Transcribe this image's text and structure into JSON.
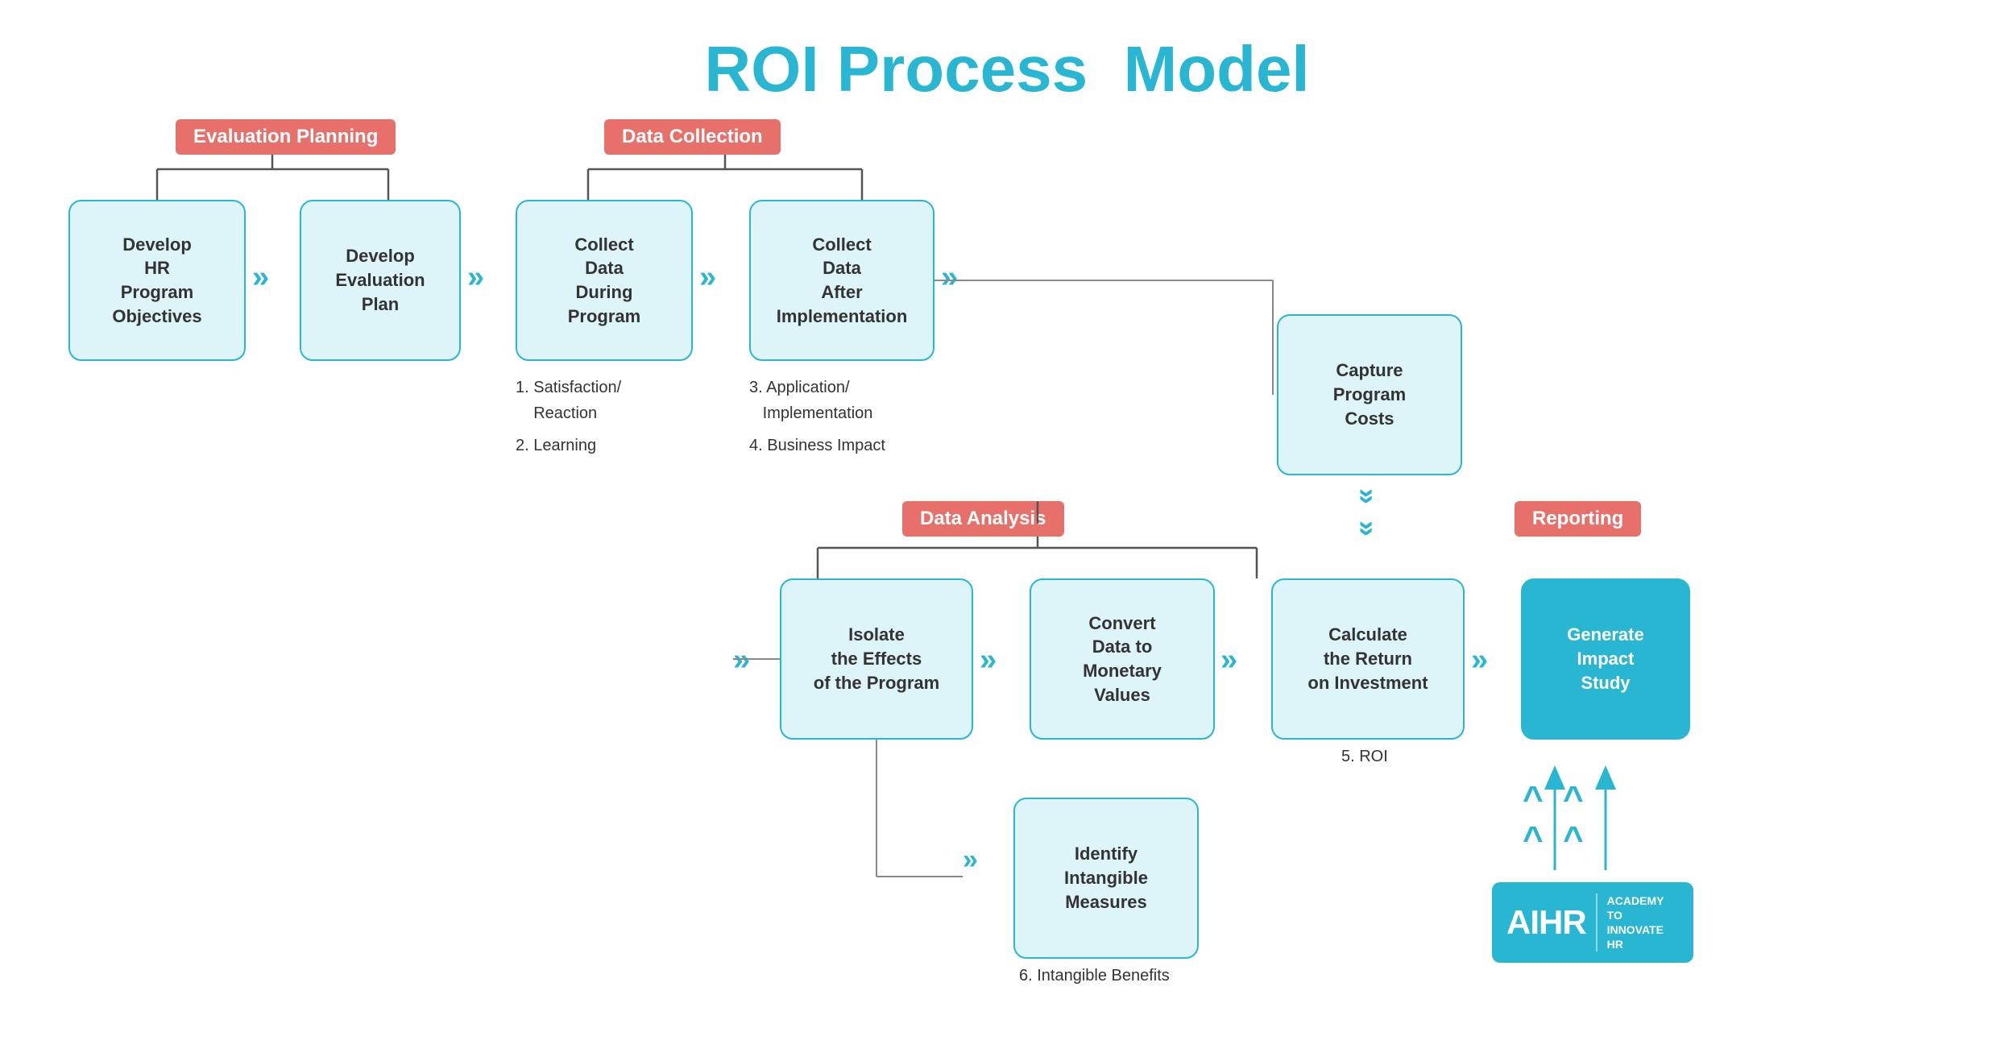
{
  "title": {
    "part1": "ROI Process",
    "part2": "Model"
  },
  "categories": {
    "evaluation_planning": "Evaluation Planning",
    "data_collection": "Data Collection",
    "data_analysis": "Data Analysis",
    "reporting": "Reporting"
  },
  "boxes": {
    "develop_hr": "Develop\nHR\nProgram\nObjectives",
    "develop_eval": "Develop\nEvaluation\nPlan",
    "collect_during": "Collect\nData\nDuring\nProgram",
    "collect_after": "Collect\nData\nAfter\nImplementation",
    "capture_costs": "Capture\nProgram\nCosts",
    "isolate": "Isolate\nthe Effects\nof the Program",
    "convert": "Convert\nData to\nMonetary\nValues",
    "calculate_roi": "Calculate\nthe Return\non Investment",
    "generate": "Generate\nImpact\nStudy",
    "identify": "Identify\nIntangible\nMeasures"
  },
  "notes": {
    "during_1": "1. Satisfaction/\n    Reaction",
    "during_2": "2. Learning",
    "after_3": "3. Application/\n    Implementation",
    "after_4": "4. Business Impact",
    "roi_label": "5. ROI",
    "intangible_label": "6. Intangible Benefits"
  },
  "aihr": {
    "text": "AIHR",
    "sub": "ACADEMY TO\nINNOVATE HR"
  }
}
